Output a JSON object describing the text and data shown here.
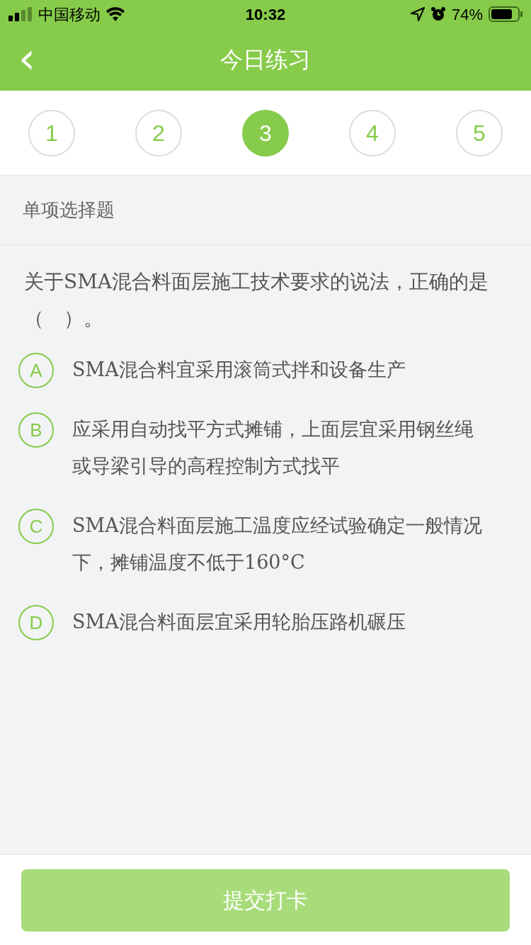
{
  "status_bar": {
    "carrier": "中国移动",
    "time": "10:32",
    "battery": "74%"
  },
  "header": {
    "back": "‹",
    "title": "今日练习"
  },
  "steps": [
    {
      "label": "1",
      "selected": false
    },
    {
      "label": "2",
      "selected": false
    },
    {
      "label": "3",
      "selected": true
    },
    {
      "label": "4",
      "selected": false
    },
    {
      "label": "5",
      "selected": false
    }
  ],
  "section": "单项选择题",
  "question": "关于SMA混合料面层施工技术要求的说法，正确的是（　）。",
  "options": [
    {
      "letter": "A",
      "text": "SMA混合料宜采用滚筒式拌和设备生产",
      "selected": false
    },
    {
      "letter": "B",
      "text": "应采用自动找平方式摊铺，上面层宜采用钢丝绳或导梁引导的高程控制方式找平",
      "selected": false
    },
    {
      "letter": "C",
      "text": "SMA混合料面层施工温度应经试验确定一般情况下，摊铺温度不低于160°C",
      "selected": false
    },
    {
      "letter": "D",
      "text": "SMA混合料面层宜采用轮胎压路机碾压",
      "selected": false
    }
  ],
  "submit": {
    "label": "提交打卡",
    "disabled": true
  }
}
